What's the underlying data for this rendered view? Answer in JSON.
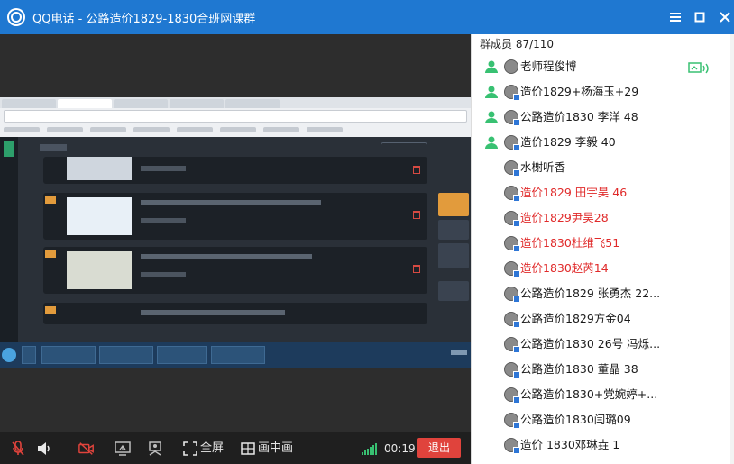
{
  "window": {
    "app_name": "QQ电话",
    "separator": "-",
    "group_name": "公路造价1829-1830合班网课群"
  },
  "members_panel": {
    "header_label": "群成员",
    "count": "87/110",
    "members": [
      {
        "name": "老师程俊博",
        "color": "normal",
        "speaking": true
      },
      {
        "name": "造价1829+杨海玉+29",
        "color": "normal",
        "speaking": true
      },
      {
        "name": "公路造价1830 李洋 48",
        "color": "normal",
        "speaking": true
      },
      {
        "name": "造价1829  李毅   40",
        "color": "normal",
        "speaking": true
      },
      {
        "name": "水榭听香",
        "color": "normal",
        "speaking": false
      },
      {
        "name": "造价1829  田宇昊 46",
        "color": "red",
        "speaking": false
      },
      {
        "name": "造价1829尹昊28",
        "color": "red",
        "speaking": false
      },
      {
        "name": "造价1830杜维飞51",
        "color": "red",
        "speaking": false
      },
      {
        "name": "造价1830赵芮14",
        "color": "red",
        "speaking": false
      },
      {
        "name": "公路造价1829 张勇杰 22...",
        "color": "normal",
        "speaking": false
      },
      {
        "name": "公路造价1829方金04",
        "color": "normal",
        "speaking": false
      },
      {
        "name": "公路造价1830   26号 冯烁...",
        "color": "normal",
        "speaking": false
      },
      {
        "name": "公路造价1830 董晶  38",
        "color": "normal",
        "speaking": false
      },
      {
        "name": "公路造价1830+党婉婷+...",
        "color": "normal",
        "speaking": false
      },
      {
        "name": "公路造价1830闫璐09",
        "color": "normal",
        "speaking": false
      },
      {
        "name": "造价  1830邓琳垚 1",
        "color": "normal",
        "speaking": false
      }
    ]
  },
  "toolbar": {
    "fullscreen_label": "全屏",
    "pip_label": "画中画",
    "call_duration": "00:19",
    "exit_label": "退出"
  },
  "colors": {
    "titlebar": "#1f78d1",
    "exit_button": "#e0433c",
    "red_name": "#e02a2a",
    "speaking_green": "#38c172"
  }
}
